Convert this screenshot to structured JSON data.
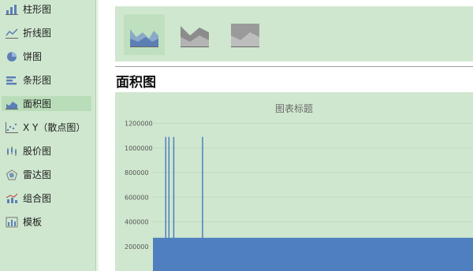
{
  "sidebar": {
    "items": [
      {
        "label": "柱形图",
        "icon": "bar-chart-icon"
      },
      {
        "label": "折线图",
        "icon": "line-chart-icon"
      },
      {
        "label": "饼图",
        "icon": "pie-chart-icon"
      },
      {
        "label": "条形图",
        "icon": "horizontal-bar-chart-icon"
      },
      {
        "label": "面积图",
        "icon": "area-chart-icon",
        "selected": true
      },
      {
        "label": "X Y（散点图）",
        "icon": "scatter-chart-icon"
      },
      {
        "label": "股价图",
        "icon": "stock-chart-icon"
      },
      {
        "label": "雷达图",
        "icon": "radar-chart-icon"
      },
      {
        "label": "组合图",
        "icon": "combo-chart-icon"
      },
      {
        "label": "模板",
        "icon": "template-icon"
      }
    ]
  },
  "subtypes": [
    {
      "icon": "area-icon",
      "selected": true
    },
    {
      "icon": "stacked-area-icon",
      "selected": false
    },
    {
      "icon": "percent-stacked-area-icon",
      "selected": false
    }
  ],
  "section": {
    "title": "面积图"
  },
  "chart_data": {
    "type": "area",
    "title": "图表标题",
    "ylim": [
      0,
      1200000
    ],
    "ytick_labels": [
      "200000",
      "400000",
      "600000",
      "800000",
      "1000000",
      "1200000"
    ],
    "grid": true,
    "series": [
      {
        "color": "#4f7fbf",
        "baseline_value": 270000,
        "spikes": [
          {
            "x": 0.04,
            "value": 1090000
          },
          {
            "x": 0.05,
            "value": 1090000
          },
          {
            "x": 0.065,
            "value": 1090000
          },
          {
            "x": 0.155,
            "value": 1090000
          }
        ]
      }
    ],
    "colors": {
      "plot_bg": "#cfe7cf",
      "grid": "#bfd9bf",
      "area": "#4f7fbf",
      "axis_text": "#555555"
    }
  }
}
